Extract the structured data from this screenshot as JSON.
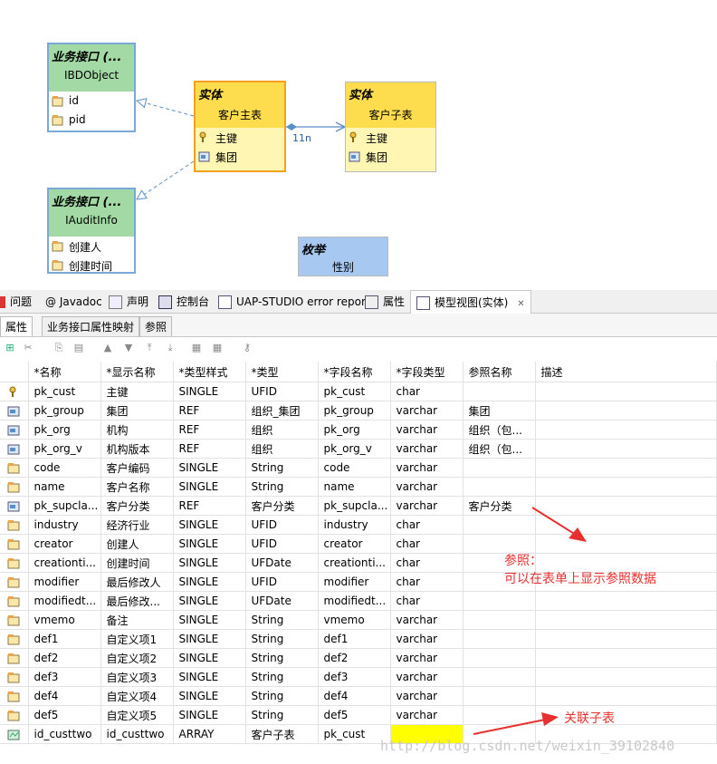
{
  "diagram": {
    "bo_object": {
      "stereotype": "业务接口 (...",
      "name": "IBDObject",
      "attrs": [
        "id",
        "pid"
      ]
    },
    "audit_info": {
      "stereotype": "业务接口 (...",
      "name": "IAuditInfo",
      "attrs": [
        "创建人",
        "创建时间"
      ]
    },
    "main_entity": {
      "stereotype": "实体",
      "name": "客户主表",
      "attrs": [
        "主键",
        "集团"
      ]
    },
    "sub_entity": {
      "stereotype": "实体",
      "name": "客户子表",
      "attrs": [
        "主键",
        "集团"
      ]
    },
    "enum": {
      "stereotype": "枚举",
      "name": "性别"
    },
    "relation_label": "11n"
  },
  "tabs": [
    {
      "label": "问题",
      "icon": "problems-icon"
    },
    {
      "label": "@ Javadoc",
      "icon": "javadoc-icon"
    },
    {
      "label": "声明",
      "icon": "declaration-icon"
    },
    {
      "label": "控制台",
      "icon": "console-icon"
    },
    {
      "label": "UAP-STUDIO error report",
      "icon": "report-icon"
    },
    {
      "label": "属性",
      "icon": "properties-icon"
    },
    {
      "label": "模型视图(实体)",
      "icon": "model-view-icon",
      "close": "✕"
    }
  ],
  "subtabs": [
    "属性",
    "业务接口属性映射",
    "参照"
  ],
  "columns": [
    "*名称",
    "*显示名称",
    "*类型样式",
    "*类型",
    "*字段名称",
    "*字段类型",
    "参照名称",
    "描述"
  ],
  "rows": [
    {
      "icon": "key",
      "cells": [
        "pk_cust",
        "主键",
        "SINGLE",
        "UFID",
        "pk_cust",
        "char",
        "",
        ""
      ]
    },
    {
      "icon": "ref",
      "cells": [
        "pk_group",
        "集团",
        "REF",
        "组织_集团",
        "pk_group",
        "varchar",
        "集团",
        ""
      ]
    },
    {
      "icon": "ref",
      "cells": [
        "pk_org",
        "机构",
        "REF",
        "组织",
        "pk_org",
        "varchar",
        "组织（包...",
        ""
      ]
    },
    {
      "icon": "ref",
      "cells": [
        "pk_org_v",
        "机构版本",
        "REF",
        "组织",
        "pk_org_v",
        "varchar",
        "组织（包...",
        ""
      ]
    },
    {
      "icon": "attr",
      "cells": [
        "code",
        "客户编码",
        "SINGLE",
        "String",
        "code",
        "varchar",
        "",
        ""
      ]
    },
    {
      "icon": "attr",
      "cells": [
        "name",
        "客户名称",
        "SINGLE",
        "String",
        "name",
        "varchar",
        "",
        ""
      ]
    },
    {
      "icon": "ref",
      "cells": [
        "pk_supcla...",
        "客户分类",
        "REF",
        "客户分类",
        "pk_supcla...",
        "varchar",
        "客户分类",
        ""
      ]
    },
    {
      "icon": "attr",
      "cells": [
        "industry",
        "经济行业",
        "SINGLE",
        "UFID",
        "industry",
        "char",
        "",
        ""
      ]
    },
    {
      "icon": "attr",
      "cells": [
        "creator",
        "创建人",
        "SINGLE",
        "UFID",
        "creator",
        "char",
        "",
        ""
      ]
    },
    {
      "icon": "attr",
      "cells": [
        "creationti...",
        "创建时间",
        "SINGLE",
        "UFDate",
        "creationti...",
        "char",
        "",
        ""
      ]
    },
    {
      "icon": "attr",
      "cells": [
        "modifier",
        "最后修改人",
        "SINGLE",
        "UFID",
        "modifier",
        "char",
        "",
        ""
      ]
    },
    {
      "icon": "attr",
      "cells": [
        "modifiedt...",
        "最后修改...",
        "SINGLE",
        "UFDate",
        "modifiedt...",
        "char",
        "",
        ""
      ]
    },
    {
      "icon": "attr",
      "cells": [
        "vmemo",
        "备注",
        "SINGLE",
        "String",
        "vmemo",
        "varchar",
        "",
        ""
      ]
    },
    {
      "icon": "attr",
      "cells": [
        "def1",
        "自定义项1",
        "SINGLE",
        "String",
        "def1",
        "varchar",
        "",
        ""
      ]
    },
    {
      "icon": "attr",
      "cells": [
        "def2",
        "自定义项2",
        "SINGLE",
        "String",
        "def2",
        "varchar",
        "",
        ""
      ]
    },
    {
      "icon": "attr",
      "cells": [
        "def3",
        "自定义项3",
        "SINGLE",
        "String",
        "def3",
        "varchar",
        "",
        ""
      ]
    },
    {
      "icon": "attr",
      "cells": [
        "def4",
        "自定义项4",
        "SINGLE",
        "String",
        "def4",
        "varchar",
        "",
        ""
      ]
    },
    {
      "icon": "attr",
      "cells": [
        "def5",
        "自定义项5",
        "SINGLE",
        "String",
        "def5",
        "varchar",
        "",
        ""
      ]
    },
    {
      "icon": "array",
      "cells": [
        "id_custtwo",
        "id_custtwo",
        "ARRAY",
        "客户子表",
        "pk_cust",
        "",
        "",
        ""
      ],
      "highlight_col": 5
    }
  ],
  "annotations": {
    "ref_note_1": "参照：",
    "ref_note_2": "可以在表单上显示参照数据",
    "sub_note": "关联子表"
  },
  "watermark": "http://blog.csdn.net/weixin_39102840",
  "colors": {
    "accent_red": "#e8312f",
    "highlight_yellow": "#ffff00",
    "entity_yellow": "#fddc4e",
    "interface_green": "#a3d9a5",
    "enum_blue": "#a7c8f1"
  }
}
